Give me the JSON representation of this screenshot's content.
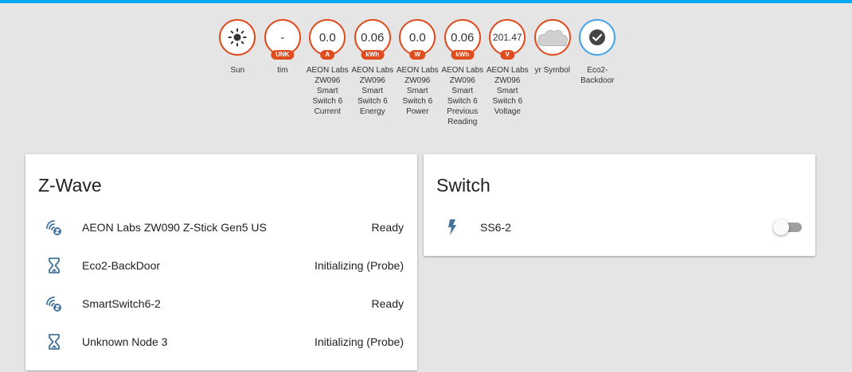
{
  "colors": {
    "accent": "#03a9f4",
    "badge_border": "#df4c1e",
    "badge_border_blue": "#44a4e6",
    "icon": "#44739e"
  },
  "badges": [
    {
      "icon": "sun-icon",
      "value": "",
      "unit": "",
      "label": "Sun"
    },
    {
      "icon": "",
      "value": "-",
      "unit": "UNK",
      "label": "tim"
    },
    {
      "icon": "",
      "value": "0.0",
      "unit": "A",
      "label": "AEON Labs ZW096 Smart Switch 6 Current"
    },
    {
      "icon": "",
      "value": "0.06",
      "unit": "kWh",
      "label": "AEON Labs ZW096 Smart Switch 6 Energy"
    },
    {
      "icon": "",
      "value": "0.0",
      "unit": "W",
      "label": "AEON Labs ZW096 Smart Switch 6 Power"
    },
    {
      "icon": "",
      "value": "0.06",
      "unit": "kWh",
      "label": "AEON Labs ZW096 Smart Switch 6 Previous Reading"
    },
    {
      "icon": "",
      "value": "201.47",
      "unit": "V",
      "label": "AEON Labs ZW096 Smart Switch 6 Voltage"
    },
    {
      "icon": "cloud-icon",
      "value": "",
      "unit": "",
      "label": "yr Symbol"
    },
    {
      "icon": "check-circle-icon",
      "value": "",
      "unit": "",
      "label": "Eco2-Backdoor"
    }
  ],
  "zwave": {
    "title": "Z-Wave",
    "rows": [
      {
        "icon": "zwave-icon",
        "name": "AEON Labs ZW090 Z-Stick Gen5 US",
        "state": "Ready"
      },
      {
        "icon": "hourglass-icon",
        "name": "Eco2-BackDoor",
        "state": "Initializing (Probe)"
      },
      {
        "icon": "zwave-icon",
        "name": "SmartSwitch6-2",
        "state": "Ready"
      },
      {
        "icon": "hourglass-icon",
        "name": "Unknown Node 3",
        "state": "Initializing (Probe)"
      }
    ]
  },
  "switch": {
    "title": "Switch",
    "rows": [
      {
        "icon": "flash-icon",
        "name": "SS6-2",
        "on": false
      }
    ]
  }
}
